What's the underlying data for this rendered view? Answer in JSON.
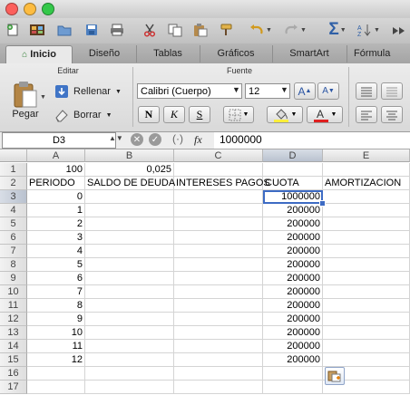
{
  "window": {
    "colors": {
      "close": "#fc605c",
      "minimize": "#fdbc40",
      "zoom": "#34c84a"
    }
  },
  "toolbar": {
    "icons": [
      "new-icon",
      "gallery-icon",
      "open-icon",
      "save-icon",
      "print-icon",
      "cut-icon",
      "copy-icon",
      "paste-icon",
      "format-painter-icon",
      "undo-icon",
      "redo-icon",
      "autosum-icon",
      "sort-icon",
      "zoom-icon"
    ]
  },
  "ribbon_tabs": [
    {
      "label": "Inicio",
      "active": true
    },
    {
      "label": "Diseño"
    },
    {
      "label": "Tablas"
    },
    {
      "label": "Gráficos"
    },
    {
      "label": "SmartArt"
    },
    {
      "label": "Fórmula"
    }
  ],
  "ribbon": {
    "editar_header": "Editar",
    "fuente_header": "Fuente",
    "paste_label": "Pegar",
    "fill_label": "Rellenar",
    "clear_label": "Borrar",
    "font_name": "Calibri (Cuerpo)",
    "font_size": "12",
    "bold": "N",
    "italic": "K",
    "underline": "S",
    "grow_font": "A",
    "shrink_font": "A"
  },
  "formula_bar": {
    "name_box": "D3",
    "fx": "fx",
    "content": "1000000"
  },
  "sheet": {
    "columns": [
      "A",
      "B",
      "C",
      "D",
      "E"
    ],
    "selected_column": "D",
    "rows": [
      {
        "n": "1",
        "A": "100",
        "B": "0,025",
        "C": "",
        "D": "",
        "E": ""
      },
      {
        "n": "2",
        "A": "PERIODO",
        "B": "SALDO DE DEUDA",
        "C": "INTERESES PAGOS",
        "D": "CUOTA",
        "E": "AMORTIZACION"
      },
      {
        "n": "3",
        "A": "0",
        "B": "",
        "C": "",
        "D": "1000000",
        "E": ""
      },
      {
        "n": "4",
        "A": "1",
        "B": "",
        "C": "",
        "D": "200000",
        "E": ""
      },
      {
        "n": "5",
        "A": "2",
        "B": "",
        "C": "",
        "D": "200000",
        "E": ""
      },
      {
        "n": "6",
        "A": "3",
        "B": "",
        "C": "",
        "D": "200000",
        "E": ""
      },
      {
        "n": "7",
        "A": "4",
        "B": "",
        "C": "",
        "D": "200000",
        "E": ""
      },
      {
        "n": "8",
        "A": "5",
        "B": "",
        "C": "",
        "D": "200000",
        "E": ""
      },
      {
        "n": "9",
        "A": "6",
        "B": "",
        "C": "",
        "D": "200000",
        "E": ""
      },
      {
        "n": "10",
        "A": "7",
        "B": "",
        "C": "",
        "D": "200000",
        "E": ""
      },
      {
        "n": "11",
        "A": "8",
        "B": "",
        "C": "",
        "D": "200000",
        "E": ""
      },
      {
        "n": "12",
        "A": "9",
        "B": "",
        "C": "",
        "D": "200000",
        "E": ""
      },
      {
        "n": "13",
        "A": "10",
        "B": "",
        "C": "",
        "D": "200000",
        "E": ""
      },
      {
        "n": "14",
        "A": "11",
        "B": "",
        "C": "",
        "D": "200000",
        "E": ""
      },
      {
        "n": "15",
        "A": "12",
        "B": "",
        "C": "",
        "D": "200000",
        "E": ""
      },
      {
        "n": "16",
        "A": "",
        "B": "",
        "C": "",
        "D": "",
        "E": ""
      },
      {
        "n": "17",
        "A": "",
        "B": "",
        "C": "",
        "D": "",
        "E": ""
      }
    ]
  }
}
